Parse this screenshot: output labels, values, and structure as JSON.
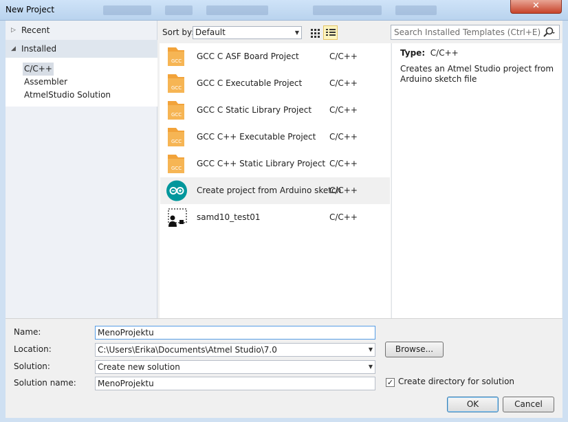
{
  "window": {
    "title": "New Project",
    "close_glyph": "✕"
  },
  "tree": {
    "recent_label": "Recent",
    "installed_label": "Installed",
    "items": [
      "C/C++",
      "Assembler",
      "AtmelStudio Solution"
    ]
  },
  "sort": {
    "label": "Sort by:",
    "value": "Default"
  },
  "search": {
    "placeholder": "Search Installed Templates (Ctrl+E)"
  },
  "templates": [
    {
      "name": "GCC C ASF Board Project",
      "lang": "C/C++",
      "icon": "gcc-folder-icon"
    },
    {
      "name": "GCC C Executable Project",
      "lang": "C/C++",
      "icon": "gcc-folder-icon"
    },
    {
      "name": "GCC C Static Library Project",
      "lang": "C/C++",
      "icon": "gcc-folder-icon"
    },
    {
      "name": "GCC C++ Executable Project",
      "lang": "C/C++",
      "icon": "gcc-folder-icon"
    },
    {
      "name": "GCC C++ Static Library Project",
      "lang": "C/C++",
      "icon": "gcc-folder-icon"
    },
    {
      "name": "Create project from Arduino sketch",
      "lang": "C/C++",
      "icon": "arduino-icon"
    },
    {
      "name": "samd10_test01",
      "lang": "C/C++",
      "icon": "user-template-icon"
    }
  ],
  "gcc_icon_text": "GCC",
  "detail": {
    "type_label": "Type:",
    "type_value": "C/C++",
    "description": "Creates an Atmel Studio project from Arduino sketch file"
  },
  "form": {
    "name_label": "Name:",
    "name_value": "MenoProjektu",
    "location_label": "Location:",
    "location_value": "C:\\Users\\Erika\\Documents\\Atmel Studio\\7.0",
    "solution_label": "Solution:",
    "solution_value": "Create new solution",
    "solution_name_label": "Solution name:",
    "solution_name_value": "MenoProjektu",
    "browse_label": "Browse...",
    "create_dir_label": "Create directory for solution",
    "create_dir_checked": true,
    "ok_label": "OK",
    "cancel_label": "Cancel"
  },
  "colors": {
    "accent": "#569de5",
    "gcc_orange": "#f2a33a",
    "arduino_teal": "#00979c"
  }
}
